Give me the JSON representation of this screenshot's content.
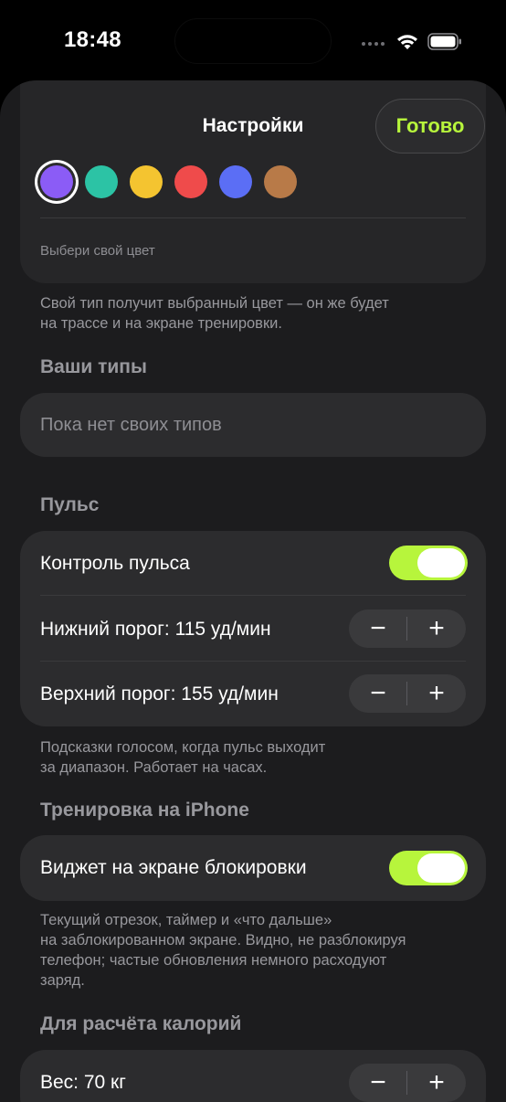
{
  "status_bar": {
    "time": "18:48"
  },
  "header": {
    "title": "Настройки",
    "done_label": "Готово"
  },
  "color_picker": {
    "swatches": [
      "#8b5cf6",
      "#2cc3a5",
      "#f4c430",
      "#ef4b4b",
      "#5b6ef5",
      "#b87a48"
    ],
    "selected_index": 0,
    "caption": "Выбери свой цвет",
    "footnote_line1": "Свой тип получит выбранный цвет — он же будет",
    "footnote_line2": "на трассе и на экране тренировки."
  },
  "your_types": {
    "header": "Ваши типы",
    "placeholder": "Пока нет своих типов"
  },
  "pulse": {
    "header": "Пульс",
    "control_label": "Контроль пульса",
    "control_on": true,
    "lower_label": "Нижний порог: 115 уд/мин",
    "upper_label": "Верхний порог: 155 уд/мин",
    "footnote_line1": "Подсказки голосом, когда пульс выходит",
    "footnote_line2": "за диапазон. Работает на часах."
  },
  "iphone_workout": {
    "header": "Тренировка на iPhone",
    "widget_label": "Виджет на экране блокировки",
    "widget_on": true,
    "footnote_line1": "Текущий отрезок, таймер и «что дальше»",
    "footnote_line2": "на заблокированном экране. Видно, не разблокируя",
    "footnote_line3": "телефон; частые обновления немного расходуют",
    "footnote_line4": "заряд."
  },
  "calories": {
    "header": "Для расчёта калорий",
    "weight_label": "Вес: 70 кг"
  },
  "stepper": {
    "minus": "−",
    "plus": "+"
  },
  "colors": {
    "accent": "#b7f53c",
    "background": "#1c1c1e",
    "card": "#2c2c2e"
  }
}
